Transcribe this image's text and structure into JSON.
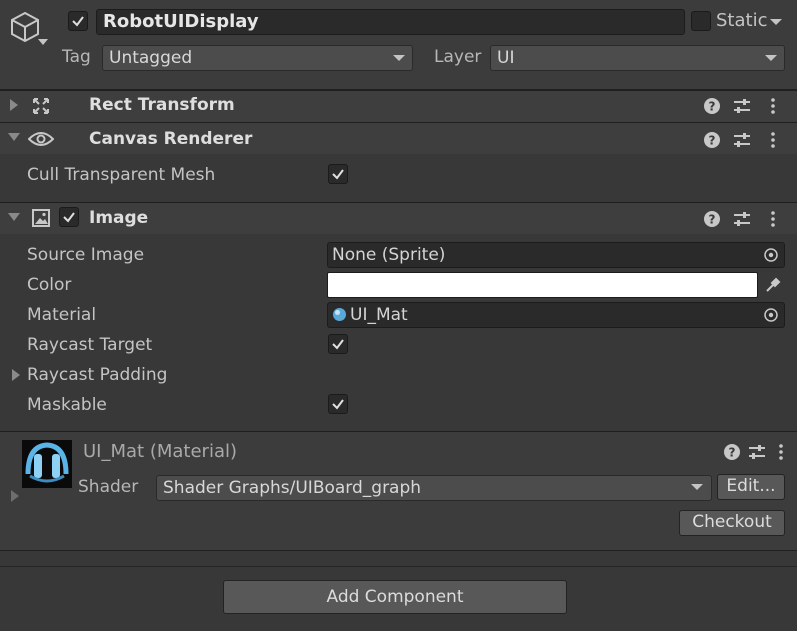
{
  "header": {
    "object_name": "RobotUIDisplay",
    "active_checked": true,
    "static_label": "Static",
    "static_checked": false,
    "tag_label": "Tag",
    "tag_value": "Untagged",
    "layer_label": "Layer",
    "layer_value": "UI"
  },
  "components": {
    "rect_transform": {
      "title": "Rect Transform"
    },
    "canvas_renderer": {
      "title": "Canvas Renderer",
      "cull_label": "Cull Transparent Mesh",
      "cull_checked": true
    },
    "image": {
      "title": "Image",
      "enabled": true,
      "source_image_label": "Source Image",
      "source_image_value": "None (Sprite)",
      "color_label": "Color",
      "color_value": "#ffffff",
      "material_label": "Material",
      "material_value": "UI_Mat",
      "raycast_target_label": "Raycast Target",
      "raycast_target_checked": true,
      "raycast_padding_label": "Raycast Padding",
      "maskable_label": "Maskable",
      "maskable_checked": true
    },
    "material": {
      "title": "UI_Mat (Material)",
      "shader_label": "Shader",
      "shader_value": "Shader Graphs/UIBoard_graph",
      "edit_label": "Edit...",
      "checkout_label": "Checkout"
    }
  },
  "add_component_label": "Add Component",
  "icons": {
    "cube": "gameobject-cube-icon",
    "rect": "rect-transform-icon",
    "eye": "canvas-renderer-eye-icon",
    "image": "image-component-icon",
    "help": "help-icon",
    "presets": "presets-icon",
    "menu": "kebab-menu-icon",
    "picker": "object-picker-icon",
    "eyedropper": "eyedropper-icon"
  },
  "colors": {
    "panel_bg": "#383838",
    "field_bg": "#2a2a2a",
    "accent_text": "#dedede"
  }
}
